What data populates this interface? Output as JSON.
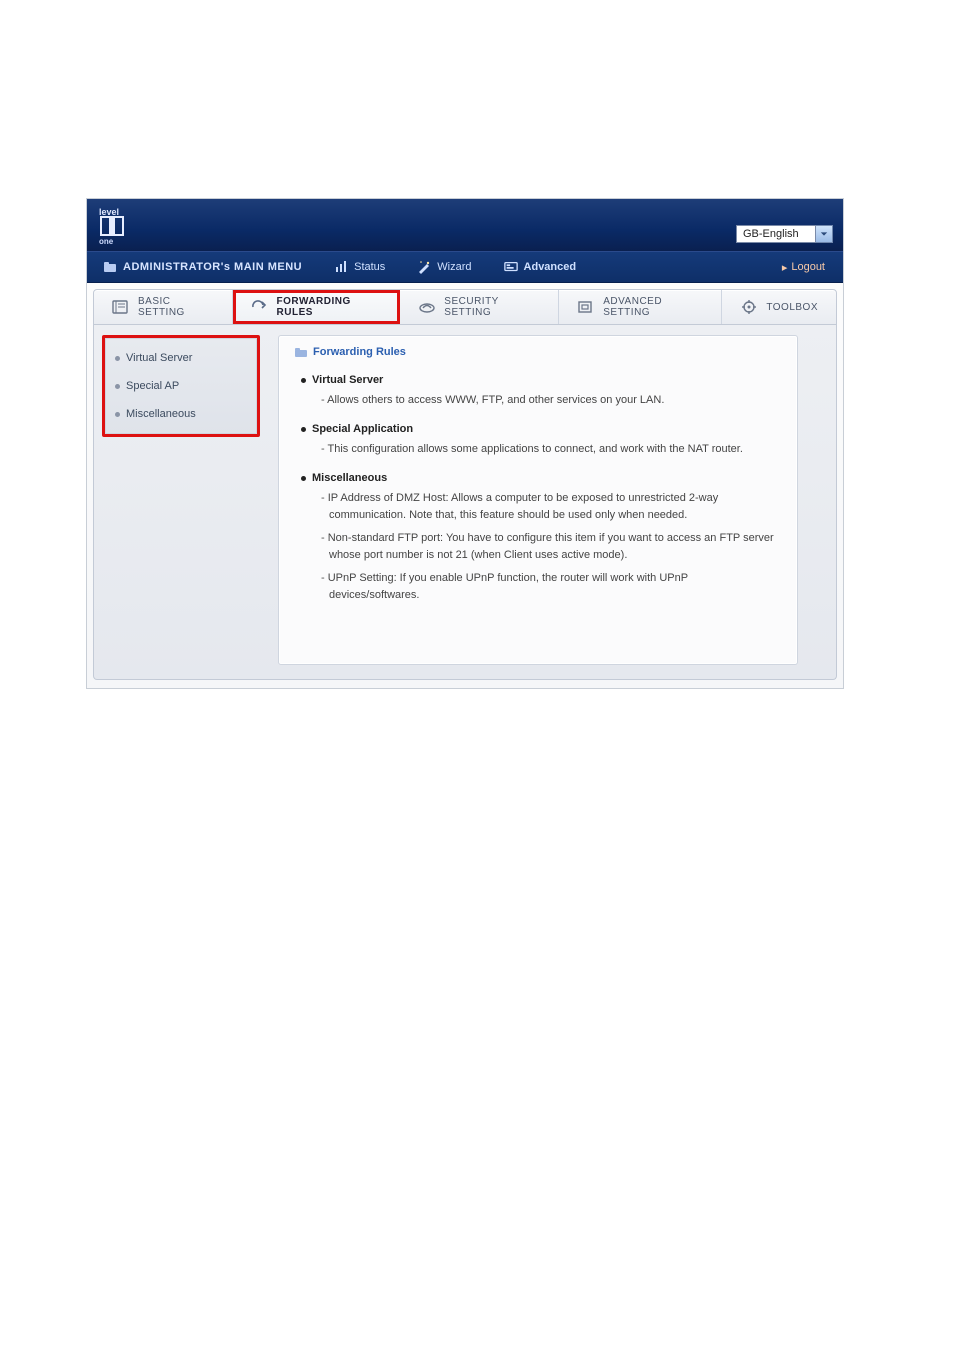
{
  "header": {
    "language": "GB-English"
  },
  "menubar": {
    "main_menu": "ADMINISTRATOR's MAIN MENU",
    "status": "Status",
    "wizard": "Wizard",
    "advanced": "Advanced",
    "logout": "Logout"
  },
  "tabs": [
    {
      "label": "BASIC SETTING"
    },
    {
      "label": "FORWARDING RULES",
      "active": true,
      "highlighted": true
    },
    {
      "label": "SECURITY SETTING"
    },
    {
      "label": "ADVANCED SETTING"
    },
    {
      "label": "TOOLBOX"
    }
  ],
  "sidebar": [
    "Virtual Server",
    "Special AP",
    "Miscellaneous"
  ],
  "panel": {
    "title": "Forwarding Rules",
    "sections": [
      {
        "title": "Virtual Server",
        "items": [
          "Allows others to access WWW, FTP, and other services on your LAN."
        ]
      },
      {
        "title": "Special Application",
        "items": [
          "This configuration allows some applications to connect, and work with the NAT router."
        ]
      },
      {
        "title": "Miscellaneous",
        "items": [
          "IP Address of DMZ Host: Allows a computer to be exposed to unrestricted 2-way communication. Note that, this feature should be used only when needed.",
          "Non-standard FTP port: You have to configure this item if you want to access an FTP server whose port number is not 21 (when Client uses active mode).",
          "UPnP Setting: If you enable UPnP function, the router will work with UPnP devices/softwares."
        ]
      }
    ]
  }
}
